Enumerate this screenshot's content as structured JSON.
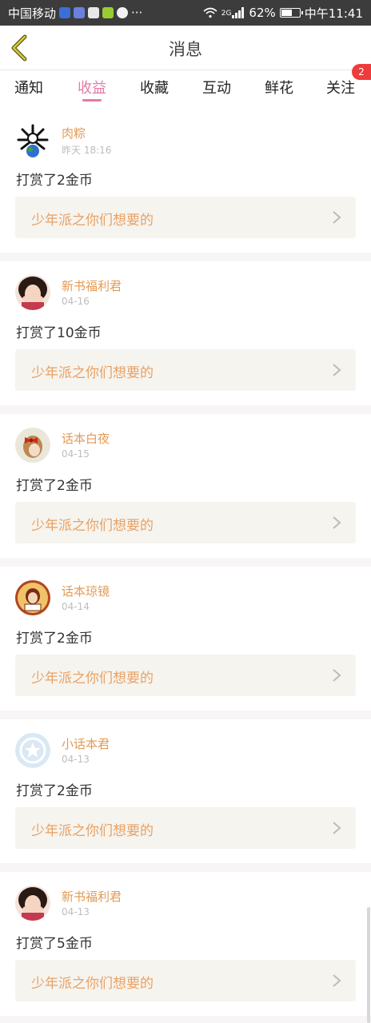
{
  "status_bar": {
    "carrier": "中国移动",
    "more": "···",
    "network": "2G",
    "battery_text": "62%",
    "battery_level": 0.62,
    "time": "中午11:41"
  },
  "header": {
    "title": "消息"
  },
  "tabs": [
    {
      "label": "通知"
    },
    {
      "label": "收益",
      "active": true
    },
    {
      "label": "收藏"
    },
    {
      "label": "互动"
    },
    {
      "label": "鲜花"
    },
    {
      "label": "关注",
      "badge": "2"
    }
  ],
  "colors": {
    "accent_pink": "#e37aa6",
    "name_orange": "#e39a55",
    "book_orange": "#e9a164",
    "badge_red": "#ef3b3b"
  },
  "messages": [
    {
      "name": "肉粽",
      "time": "昨天 18:16",
      "action": "打赏了2金币",
      "book": "少年派之你们想要的",
      "avatar_icon": "rice-dumpling-avatar"
    },
    {
      "name": "新书福利君",
      "time": "04-16",
      "action": "打赏了10金币",
      "book": "少年派之你们想要的",
      "avatar_icon": "girl-photo-avatar"
    },
    {
      "name": "话本白夜",
      "time": "04-15",
      "action": "打赏了2金币",
      "book": "少年派之你们想要的",
      "avatar_icon": "girl-red-bow-avatar"
    },
    {
      "name": "话本琼镜",
      "time": "04-14",
      "action": "打赏了2金币",
      "book": "少年派之你们想要的",
      "avatar_icon": "portrait-frame-avatar"
    },
    {
      "name": "小话本君",
      "time": "04-13",
      "action": "打赏了2金币",
      "book": "少年派之你们想要的",
      "avatar_icon": "default-star-avatar"
    },
    {
      "name": "新书福利君",
      "time": "04-13",
      "action": "打赏了5金币",
      "book": "少年派之你们想要的",
      "avatar_icon": "girl-photo-avatar"
    }
  ]
}
